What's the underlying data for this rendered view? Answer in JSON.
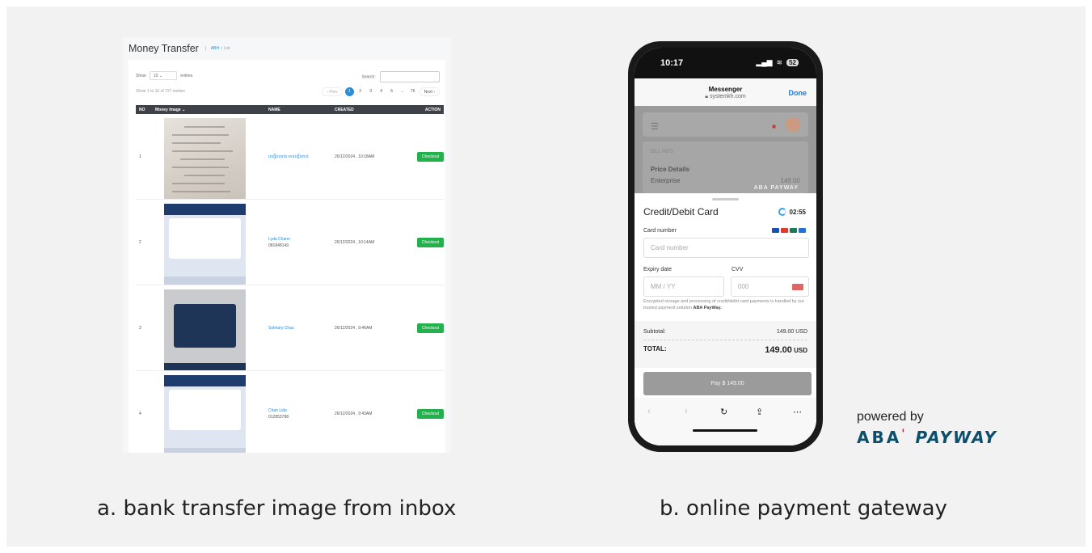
{
  "admin": {
    "title": "Money Transfer",
    "breadcrumb_home": "ABH",
    "breadcrumb_sep": ">",
    "breadcrumb_current": "List",
    "show_label": "Show",
    "show_value": "10",
    "entries_label": "entries",
    "search_label": "Search:",
    "search_value": "",
    "info": "Show 1 to 10 of 727 entries",
    "pagination": [
      "‹ Prev",
      "1",
      "2",
      "3",
      "4",
      "5",
      "...",
      "76",
      "Next ›"
    ],
    "active_page": "1",
    "columns": [
      "NO",
      "Money Image",
      "NAME",
      "CREATED",
      "ACTION"
    ],
    "rows": [
      {
        "no": "1",
        "name_line1": "ឈឿងឈាង មាន់ឡើងតាន់",
        "name_line2": "",
        "created": "26/12/2024 , 10:18AM",
        "action": "Checkout"
      },
      {
        "no": "2",
        "name_line1": "Lyda Chann",
        "name_line2": "081848149",
        "created": "26/12/2024 , 10:14AM",
        "action": "Checkout"
      },
      {
        "no": "3",
        "name_line1": "Sokhary Chau",
        "name_line2": "",
        "created": "26/12/2024 , 9:46AM",
        "action": "Checkout"
      },
      {
        "no": "4",
        "name_line1": "Chan Lida",
        "name_line2": "012853788",
        "created": "26/12/2024 , 9:43AM",
        "action": "Checkout"
      }
    ]
  },
  "phone": {
    "time": "10:17",
    "battery": "52",
    "browser_title": "Messenger",
    "browser_url": "systemkh.com",
    "done_label": "Done",
    "bill_info": "BILL INFO",
    "price_details": "Price Details",
    "plan": "Enterprise",
    "plan_price": "149.00",
    "watermark": "ABA PAYWAY",
    "sheet_title": "Credit/Debit Card",
    "timer": "02:55",
    "card_number_label": "Card number",
    "card_number_placeholder": "Card number",
    "expiry_label": "Expiry date",
    "expiry_placeholder": "MM / YY",
    "cvv_label": "CVV",
    "cvv_placeholder": "000",
    "note_text": "Encrypted storage and processing of credit/debit card payments is handled by our trusted payment solution",
    "note_brand": "ABA PayWay.",
    "subtotal_label": "Subtotal:",
    "subtotal_value": "149.00 USD",
    "total_label": "TOTAL:",
    "total_amount": "149.00",
    "total_currency": "USD",
    "pay_label": "Pay $ 149.00"
  },
  "powered": {
    "text": "powered by",
    "logo_aba": "ABA",
    "logo_mark": "'",
    "logo_payway": "PAYWAY"
  },
  "captions": {
    "left": "a. bank transfer image from inbox",
    "right": "b. online payment gateway"
  },
  "colors": {
    "accent_blue": "#2a8cd6",
    "checkout_green": "#22b24c",
    "aba_teal": "#0b4f6c",
    "aba_red": "#dd2222"
  }
}
